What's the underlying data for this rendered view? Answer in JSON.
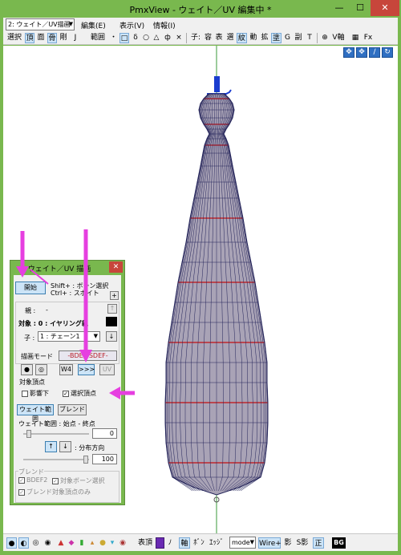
{
  "window": {
    "title": "PmxView - ウェイト／UV 編集中 *",
    "min_glyph": "—",
    "max_glyph": "☐",
    "close_glyph": "✕"
  },
  "menubar": {
    "model_select": "2: ウェイト／UV描画",
    "items": [
      "編集(E)",
      "表示(V)",
      "情報(I)"
    ]
  },
  "toolbar": {
    "items": [
      "選択",
      "頂",
      "面",
      "骨",
      "剛",
      "J",
      "範囲",
      "・",
      "□",
      "δ",
      "○",
      "△",
      "ф",
      "×",
      "子:",
      "容",
      "表",
      "選",
      "紋",
      "動",
      "拡",
      "塗",
      "G",
      "副",
      "T",
      "V軸",
      "Fx"
    ]
  },
  "nav_icons": [
    "✥",
    "✥",
    "∕",
    "↻"
  ],
  "bottombar": {
    "items": [
      "表頂",
      "ﾉ",
      "軸",
      "ﾎﾞﾝ",
      "ｴｯｼﾞ",
      "Wire+",
      "影",
      "S影",
      "正"
    ],
    "mode_select": "mode",
    "bg_label": "BG"
  },
  "dialog": {
    "title": "ウェイト／UV 描画",
    "close_glyph": "✕",
    "start_button": "開始",
    "shift_hint": "Shift+ : ボーン選択",
    "ctrl_hint": "Ctrl+ : スポイト",
    "plus_button": "+",
    "parent_label": "親 :",
    "parent_value": "-",
    "target_label": "対象 : 0 : イヤリング親",
    "child_label": "子 :",
    "child_select": "1 : チェーン1",
    "draw_mode_label": "描画モード",
    "bdef_label": "-BDEF",
    "sdef_label": "SDEF-",
    "mode_buttons": [
      "●",
      "◎",
      "W4",
      ">>>",
      "UV"
    ],
    "target_vertex_label": "対象頂点",
    "under_shadow": "影響下",
    "selected_vertex": "選択頂点",
    "weight_range_button": "ウェイト範囲",
    "blend_button": "ブレンド",
    "weight_range_text": "ウェイト範囲 : 始点 - 終点",
    "start_value": "0",
    "end_value": "100",
    "distribution_label": ": 分布方向",
    "blend_group_label": "ブレンド",
    "bdef2": "BDEF2",
    "target_bone_select": "対象ボーン選択",
    "blend_target_only": "ブレンド対象頂点のみ"
  },
  "colors": {
    "window_frame": "#79b84e",
    "close_red": "#c7463b",
    "mesh_fill": "#a9a3b6",
    "mesh_line": "#24245a",
    "vertex_red": "#c0282d",
    "annotation_arrow": "#e63fe0",
    "bone_blue": "#1a3ccf"
  }
}
